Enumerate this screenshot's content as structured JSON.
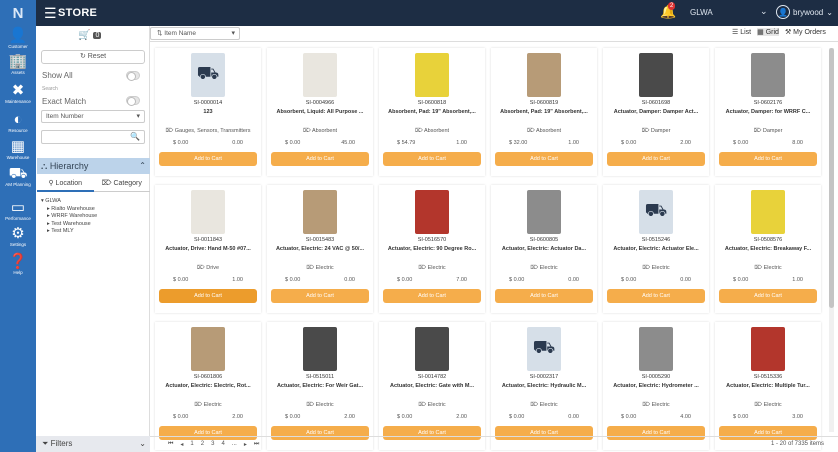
{
  "header": {
    "logo": "N",
    "title": "STORE",
    "notifications": "2",
    "company": "GLWA",
    "user": "brywood"
  },
  "nav": [
    {
      "label": "Customer",
      "icon": "user-icon"
    },
    {
      "label": "Assets",
      "icon": "building-icon"
    },
    {
      "label": "Maintenance",
      "icon": "tools-icon"
    },
    {
      "label": "Resource",
      "icon": "resource-icon"
    },
    {
      "label": "Warehouse",
      "icon": "warehouse-icon"
    },
    {
      "label": "AM Planning",
      "icon": "planning-icon"
    },
    {
      "label": "Performance",
      "icon": "monitor-icon"
    },
    {
      "label": "Settings",
      "icon": "gear-icon"
    },
    {
      "label": "Help",
      "icon": "help-icon"
    }
  ],
  "filters": {
    "cart_count": "0",
    "reset_label": "Reset",
    "show_all_label": "Show All",
    "search_label": "Search",
    "exact_match_label": "Exact Match",
    "search_field": "Item Number",
    "hierarchy_label": "Hierarchy",
    "location_tab": "Location",
    "category_tab": "Category",
    "tree_root": "GLWA",
    "tree_children": [
      "Rialto Warehouse",
      "WRRF Warehouse",
      "Test Warehouse",
      "Test MLY"
    ],
    "filters_label": "Filters"
  },
  "toolbar": {
    "sort_label": "Item Name",
    "list_label": "List",
    "grid_label": "Grid",
    "orders_label": "My Orders"
  },
  "add_label": "Add to Cart",
  "items": [
    {
      "sku": "SI-0000014",
      "name": "123",
      "category": "Gauges, Sensors, Transmitters",
      "price": "$ 0.00",
      "qty": "0.00",
      "img": "placeholder"
    },
    {
      "sku": "SI-0004966",
      "name": "Absorbent, Liquid: All Purpose ...",
      "category": "Absorbent",
      "price": "$ 0.00",
      "qty": "45.00",
      "img": "white"
    },
    {
      "sku": "SI-0600818",
      "name": "Absorbent, Pad: 19\" Absorbent,...",
      "category": "Absorbent",
      "price": "$ 54.79",
      "qty": "1.00",
      "img": "yellow"
    },
    {
      "sku": "SI-0600819",
      "name": "Absorbent, Pad: 19\" Absorbent,...",
      "category": "Absorbent",
      "price": "$ 32.00",
      "qty": "1.00",
      "img": "tan"
    },
    {
      "sku": "SI-0601698",
      "name": "Actuator, Damper: Damper Act...",
      "category": "Damper",
      "price": "$ 0.00",
      "qty": "2.00",
      "img": "dark"
    },
    {
      "sku": "SI-0602176",
      "name": "Actuator, Damper: for WRRF C...",
      "category": "Damper",
      "price": "$ 0.00",
      "qty": "8.00",
      "img": "gray"
    },
    {
      "sku": "SI-0011843",
      "name": "Actuator, Drive: Hand M-50 #07...",
      "category": "Drive",
      "price": "$ 0.00",
      "qty": "1.00",
      "img": "white"
    },
    {
      "sku": "SI-0015483",
      "name": "Actuator, Electric: 24 VAC @ 50/...",
      "category": "Electric",
      "price": "$ 0.00",
      "qty": "0.00",
      "img": "tan"
    },
    {
      "sku": "SI-0516570",
      "name": "Actuator, Electric: 90 Degree Ro...",
      "category": "Electric",
      "price": "$ 0.00",
      "qty": "7.00",
      "img": "red"
    },
    {
      "sku": "SI-0600805",
      "name": "Actuator, Electric: Actuator Da...",
      "category": "Electric",
      "price": "$ 0.00",
      "qty": "0.00",
      "img": "gray"
    },
    {
      "sku": "SI-0515246",
      "name": "Actuator, Electric: Actuator Ele...",
      "category": "Electric",
      "price": "$ 0.00",
      "qty": "0.00",
      "img": "placeholder"
    },
    {
      "sku": "SI-0508576",
      "name": "Actuator, Electric: Breakaway F...",
      "category": "Electric",
      "price": "$ 0.00",
      "qty": "1.00",
      "img": "yellow"
    },
    {
      "sku": "SI-0601806",
      "name": "Actuator, Electric: Electric, Rot...",
      "category": "Electric",
      "price": "$ 0.00",
      "qty": "2.00",
      "img": "tan"
    },
    {
      "sku": "SI-0515011",
      "name": "Actuator, Electric: For Weir Gat...",
      "category": "Electric",
      "price": "$ 0.00",
      "qty": "2.00",
      "img": "dark"
    },
    {
      "sku": "SI-0014782",
      "name": "Actuator, Electric: Gate with M...",
      "category": "Electric",
      "price": "$ 0.00",
      "qty": "2.00",
      "img": "dark"
    },
    {
      "sku": "SI-0002317",
      "name": "Actuator, Electric: Hydraulic M...",
      "category": "Electric",
      "price": "$ 0.00",
      "qty": "0.00",
      "img": "placeholder"
    },
    {
      "sku": "SI-0005290",
      "name": "Actuator, Electric: Hydrometer ...",
      "category": "Electric",
      "price": "$ 0.00",
      "qty": "4.00",
      "img": "gray"
    },
    {
      "sku": "SI-0515336",
      "name": "Actuator, Electric: Multiple Tur...",
      "category": "Electric",
      "price": "$ 0.00",
      "qty": "3.00",
      "img": "red"
    }
  ],
  "image_colors": {
    "placeholder": "#d6dfe8",
    "white": "#e9e6df",
    "yellow": "#e8d23a",
    "tan": "#b79b77",
    "dark": "#4a4a4a",
    "gray": "#8c8c8c",
    "red": "#b3362c"
  },
  "pager": {
    "pages": [
      "1",
      "2",
      "3",
      "4",
      "..."
    ],
    "info": "1 - 20 of 7335 items"
  }
}
